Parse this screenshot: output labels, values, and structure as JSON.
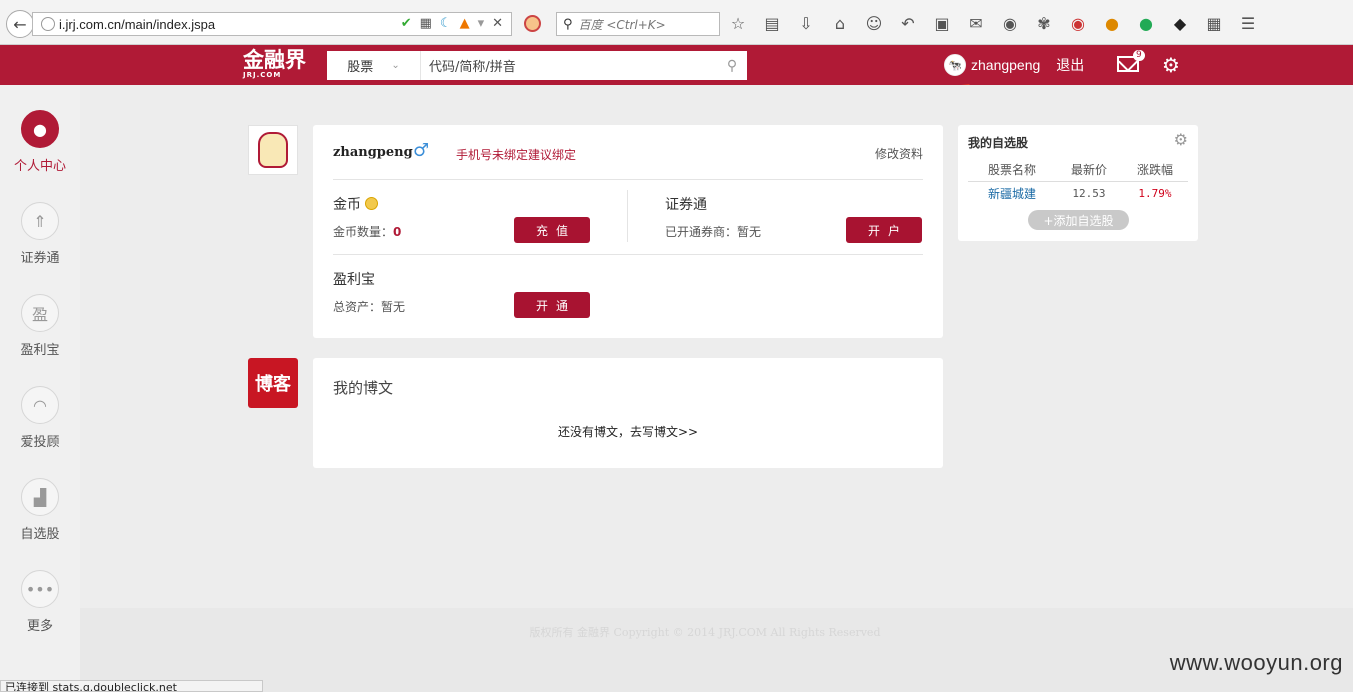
{
  "browser": {
    "url": "i.jrj.com.cn/main/index.jspa",
    "search_placeholder": "百度 <Ctrl+K>"
  },
  "header": {
    "logo": "金融界",
    "logo_sub": "JRJ.COM",
    "search_type": "股票",
    "search_placeholder": "代码/简称/拼音",
    "username": "zhangpeng",
    "logout": "退出",
    "mail_count": "9"
  },
  "sidebar": {
    "items": [
      {
        "label": "个人中心",
        "active": true
      },
      {
        "label": "证券通"
      },
      {
        "label": "盈利宝"
      },
      {
        "label": "爱投顾"
      },
      {
        "label": "自选股"
      },
      {
        "label": "更多"
      }
    ],
    "icon_glyphs": [
      "●",
      "⇑",
      "盈",
      "◠",
      "▟",
      "•••"
    ]
  },
  "profile": {
    "username": "zhangpeng",
    "gender_icon": "♂",
    "phone_notice": "手机号未绑定建议绑定",
    "edit_link": "修改资料",
    "coins": {
      "title": "金币",
      "count_label": "金币数量：",
      "count_value": "0",
      "button": "充值"
    },
    "securities": {
      "title": "证券通",
      "status": "已开通券商：暂无",
      "button": "开户"
    },
    "yinglibao": {
      "title": "盈利宝",
      "status": "总资产：暂无",
      "button": "开通"
    }
  },
  "blog": {
    "badge": "博客",
    "title": "我的博文",
    "empty_text": "还没有博文，去写博文>>"
  },
  "watchlist": {
    "title": "我的自选股",
    "columns": [
      "股票名称",
      "最新价",
      "涨跌幅"
    ],
    "rows": [
      {
        "name": "新疆城建",
        "price": "12.53",
        "change": "1.79%"
      }
    ],
    "add_button": "+添加自选股"
  },
  "footer": {
    "copyright": "版权所有 金融界 Copyright © 2014 JRJ.COM All Rights Reserved"
  },
  "watermark": "www.wooyun.org",
  "status_bar": "已连接到 stats.g.doubleclick.net",
  "colors": {
    "brand_red": "#b01a36",
    "button_red": "#a81331",
    "link_blue": "#1a6aa5"
  }
}
